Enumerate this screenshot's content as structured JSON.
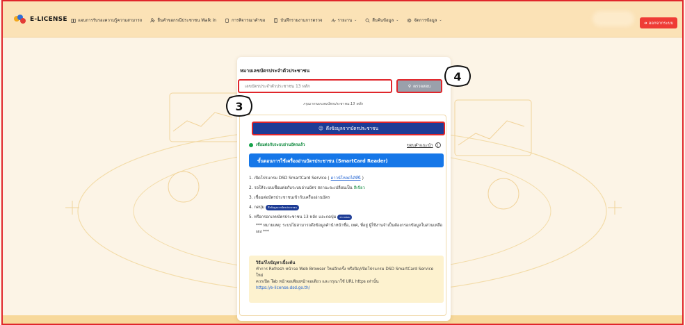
{
  "header": {
    "logo": "E-LICENSE",
    "nav": [
      {
        "label": "แผนการรับรองความรู้ความสามารถ",
        "icon": "book-icon",
        "has_dropdown": false
      },
      {
        "label": "ยื่นคำขอกรณีประชาชน Walk in",
        "icon": "person-plus-icon",
        "has_dropdown": false
      },
      {
        "label": "การพิจารณาคำขอ",
        "icon": "clipboard-icon",
        "has_dropdown": false
      },
      {
        "label": "บันทึกรายงานการตรวจ",
        "icon": "report-icon",
        "has_dropdown": false
      },
      {
        "label": "รายงาน",
        "icon": "activity-icon",
        "has_dropdown": true
      },
      {
        "label": "สืบค้นข้อมูล",
        "icon": "search-icon",
        "has_dropdown": true
      },
      {
        "label": "จัดการข้อมูล",
        "icon": "gear-icon",
        "has_dropdown": true
      }
    ],
    "logout": "ออกจากระบบ"
  },
  "form": {
    "label": "หมายเลขบัตรประจำตัวประชาชน",
    "input_placeholder": "เลขบัตรประจำตัวประชาชน 13 หลัก",
    "check_button": "ตรวจสอบ",
    "hint": "กรุณากรอกเลขบัตรประชาชน 13 หลัก"
  },
  "smartcard": {
    "pull_button": "ดึงข้อมูลจากบัตรประชาชน",
    "status": "เชื่อมต่อกับระบบอ่านบัตรแล้ว",
    "how_to": "ขอบคำแนะนำ",
    "steps_title": "ขั้นตอนการใช้เครื่องอ่านบัตรประชาชน (SmartCard Reader)",
    "step1": "1. เปิดโปรแกรม DSD SmartCard Service (",
    "step1_link": "ดาวน์โหลดได้ที่นี่",
    "step1_end": ")",
    "step2": "2. รอให้ระบบเชื่อมต่อกับระบบอ่านบัตร สถานะจะเปลี่ยนเป็น",
    "step2_green": "สีเขียว",
    "step3": "3. เชื่อมต่อบัตรประชาชนเข้ากับเครื่องอ่านบัตร",
    "step4": "4. กดปุ่ม",
    "step4_pill": "ดึงข้อมูลจากบัตรประชาชน",
    "step5": "5. หรือกรอกเลขบัตรประชาชน 13 หลัก และกดปุ่ม",
    "step5_pill": "ตรวจสอบ",
    "note": "*** หมายเหตุ: ระบบไม่สามารถดึงข้อมูลคำนำหน้าชื่อ, เพศ, ที่อยู่ ผู้ใช้งานจำเป็นต้องกรอกข้อมูลในส่วนเหลือเอง ***"
  },
  "fix": {
    "title": "วิธีแก้ไขปัญหาเบื้องต้น",
    "line1": "ทำการ Refresh หน้าจอ Web Browser ใหม่อีกครั้ง หรือปิด/เปิดโปรแกรม DSD SmartCard Service ใหม่",
    "line2": "ควรเปิด Tab หน้าจอเพียงหน้าจอเดียว และกรุณาใช้ URL https เท่านั้น",
    "url": "https://e-license.dsd.go.th/"
  },
  "markers": {
    "input": "3",
    "button": "4"
  },
  "colors": {
    "accent": "#e0262b",
    "primary": "#1d3c96",
    "info": "#1677e8",
    "success": "#16a34a"
  }
}
